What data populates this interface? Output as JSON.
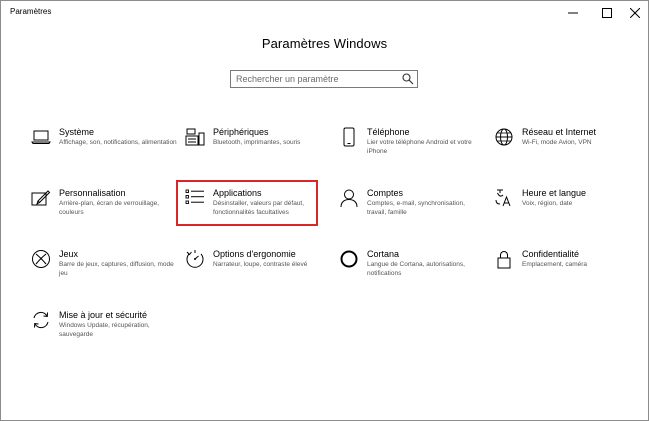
{
  "window": {
    "title": "Paramètres"
  },
  "page": {
    "title": "Paramètres Windows"
  },
  "search": {
    "placeholder": "Rechercher un paramètre"
  },
  "colors": {
    "highlight": "#d9262b",
    "text": "#000000",
    "description": "#555555"
  },
  "tiles": [
    {
      "name": "Système",
      "description": "Affichage, son, notifications, alimentation",
      "icon": "laptop-icon"
    },
    {
      "name": "Périphériques",
      "description": "Bluetooth, imprimantes, souris",
      "icon": "keyboard-printer-icon"
    },
    {
      "name": "Téléphone",
      "description": "Lier votre téléphone Android et votre iPhone",
      "icon": "phone-icon"
    },
    {
      "name": "Réseau et Internet",
      "description": "Wi-Fi, mode Avion, VPN",
      "icon": "globe-icon"
    },
    {
      "name": "Personnalisation",
      "description": "Arrière-plan, écran de verrouillage, couleurs",
      "icon": "paint-icon"
    },
    {
      "name": "Applications",
      "description": "Désinstaller, valeurs par défaut, fonctionnalités facultatives",
      "icon": "apps-list-icon"
    },
    {
      "name": "Comptes",
      "description": "Comptes, e-mail, synchronisation, travail, famille",
      "icon": "person-icon"
    },
    {
      "name": "Heure et langue",
      "description": "Voix, région, date",
      "icon": "time-language-icon"
    },
    {
      "name": "Jeux",
      "description": "Barre de jeux, captures, diffusion, mode jeu",
      "icon": "xbox-icon"
    },
    {
      "name": "Options d'ergonomie",
      "description": "Narrateur, loupe, contraste élevé",
      "icon": "ease-of-access-icon"
    },
    {
      "name": "Cortana",
      "description": "Langue de Cortana, autorisations, notifications",
      "icon": "cortana-icon"
    },
    {
      "name": "Confidentialité",
      "description": "Emplacement, caméra",
      "icon": "lock-icon"
    },
    {
      "name": "Mise à jour et sécurité",
      "description": "Windows Update, récupération, sauvegarde",
      "icon": "sync-icon"
    }
  ]
}
